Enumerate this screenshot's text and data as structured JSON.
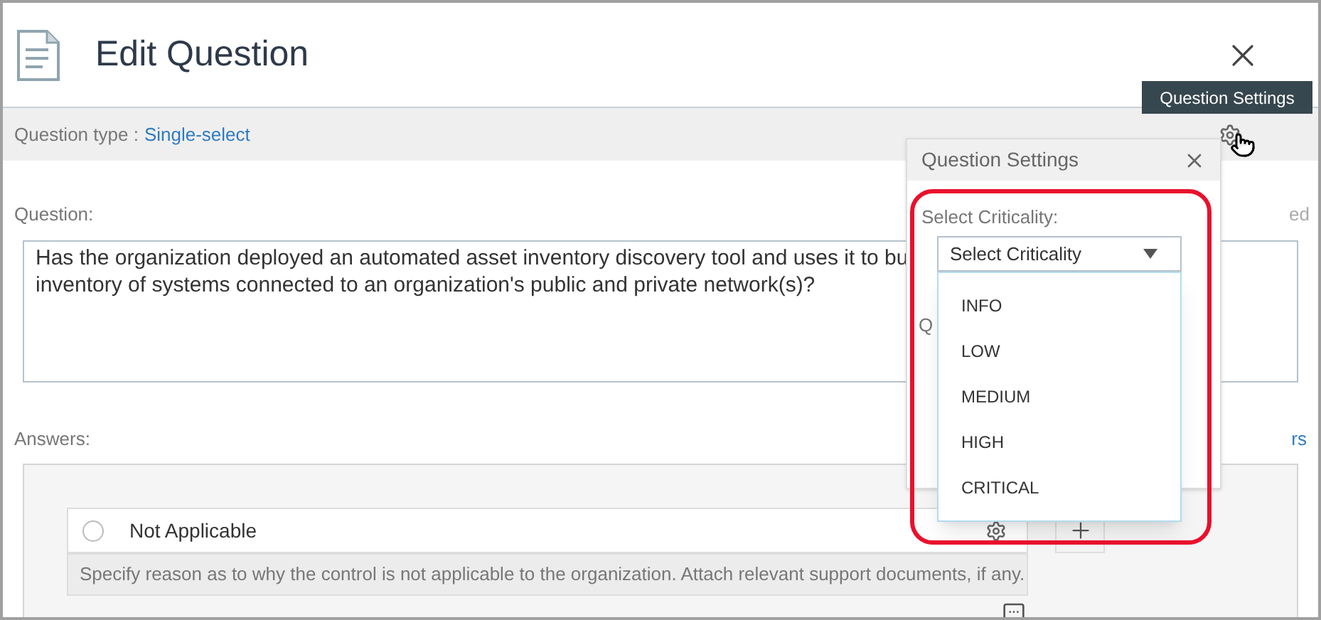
{
  "window": {
    "title": "Edit Question"
  },
  "question_type": {
    "label": "Question type :",
    "value": "Single-select"
  },
  "question": {
    "label": "Question:",
    "lines": [
      "Has the organization deployed an automated asset inventory discovery tool and uses it to bu",
      "inventory of systems connected to an organization's public and private network(s)?"
    ]
  },
  "partial_right_label": "ed",
  "answers": {
    "label": "Answers:",
    "partial_right_label": "rs",
    "items": [
      {
        "label": "Not Applicable",
        "selected": false,
        "hint": "Specify reason as to why the control is not applicable to the organization. Attach relevant support documents, if any."
      }
    ]
  },
  "tooltip": "Question Settings",
  "settings_panel": {
    "title": "Question Settings",
    "criticality_label": "Select Criticality:",
    "select": {
      "placeholder": "Select Criticality",
      "expanded": true,
      "options": [
        "INFO",
        "LOW",
        "MEDIUM",
        "HIGH",
        "CRITICAL"
      ]
    },
    "partial_label": "Q"
  }
}
